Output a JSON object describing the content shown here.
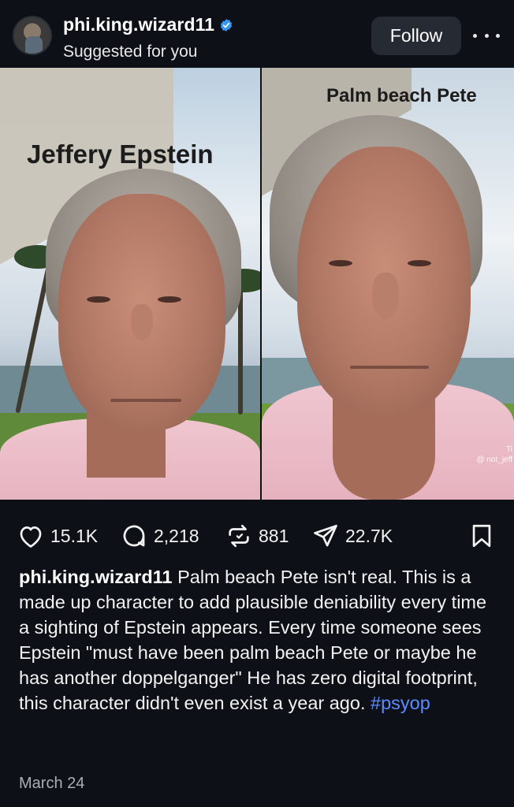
{
  "header": {
    "username": "phi.king.wizard11",
    "subtitle": "Suggested for you",
    "follow_label": "Follow"
  },
  "media": {
    "left_overlay": "Jeffery Epstein",
    "right_overlay": "Palm beach Pete",
    "watermark_line1": "Ti",
    "watermark_line2": "@ not_jeff"
  },
  "actions": {
    "likes": "15.1K",
    "comments": "2,218",
    "reposts": "881",
    "shares": "22.7K"
  },
  "caption": {
    "username": "phi.king.wizard11",
    "text": " Palm beach Pete isn't real. This is a made up character to add plausible deniability every time a sighting of Epstein appears. Every time someone sees Epstein \"must have been palm beach Pete or maybe he has another doppelganger\" He has zero digital footprint, this character didn't even exist a year ago. ",
    "hashtag": "#psyop"
  },
  "date": "March 24",
  "colors": {
    "background": "#0d1117",
    "hashtag": "#5b8cff",
    "verified": "#3897f0",
    "follow_button": "#262b33"
  }
}
